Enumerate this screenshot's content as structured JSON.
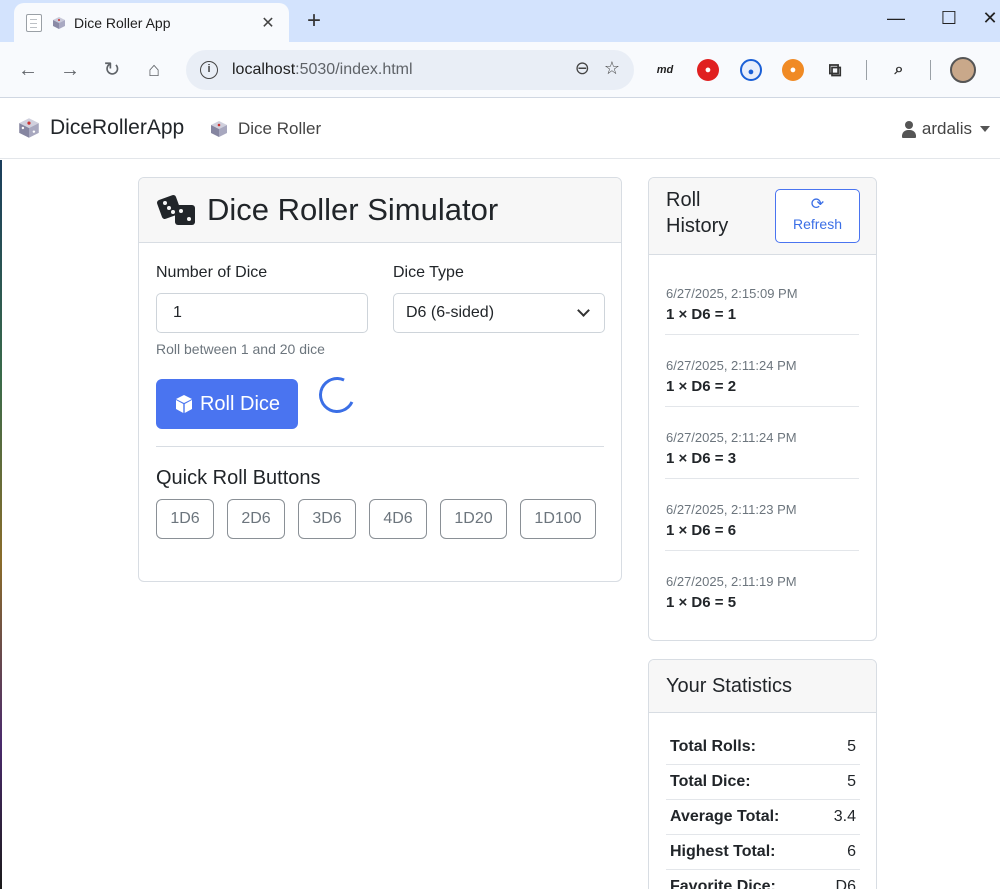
{
  "browser": {
    "tab_title": "Dice Roller App",
    "new_tab": "+",
    "url_host": "localhost",
    "url_rest": ":5030/index.html",
    "extensions": [
      "md"
    ]
  },
  "navbar": {
    "brand": "DiceRollerApp",
    "link": "Dice Roller",
    "user": "ardalis"
  },
  "roller": {
    "title": "Dice Roller Simulator",
    "num_label": "Number of Dice",
    "num_value": "1",
    "num_hint": "Roll between 1 and 20 dice",
    "type_label": "Dice Type",
    "type_value": "D6 (6-sided)",
    "roll_label": "Roll Dice",
    "quick_title": "Quick Roll Buttons",
    "quick": [
      "1D6",
      "2D6",
      "3D6",
      "4D6",
      "1D20",
      "1D100"
    ]
  },
  "history": {
    "title": "Roll History",
    "refresh_label": "Refresh",
    "items": [
      {
        "time": "6/27/2025, 2:15:09 PM",
        "result": "1 × D6 = 1"
      },
      {
        "time": "6/27/2025, 2:11:24 PM",
        "result": "1 × D6 = 2"
      },
      {
        "time": "6/27/2025, 2:11:24 PM",
        "result": "1 × D6 = 3"
      },
      {
        "time": "6/27/2025, 2:11:23 PM",
        "result": "1 × D6 = 6"
      },
      {
        "time": "6/27/2025, 2:11:19 PM",
        "result": "1 × D6 = 5"
      }
    ]
  },
  "stats": {
    "title": "Your Statistics",
    "rows": [
      {
        "label": "Total Rolls:",
        "value": "5"
      },
      {
        "label": "Total Dice:",
        "value": "5"
      },
      {
        "label": "Average Total:",
        "value": "3.4"
      },
      {
        "label": "Highest Total:",
        "value": "6"
      },
      {
        "label": "Favorite Dice:",
        "value": "D6"
      }
    ]
  },
  "colors": {
    "primary": "#4a74f0",
    "tabstrip": "#d3e3fd",
    "toolbar": "#f8fafd"
  }
}
